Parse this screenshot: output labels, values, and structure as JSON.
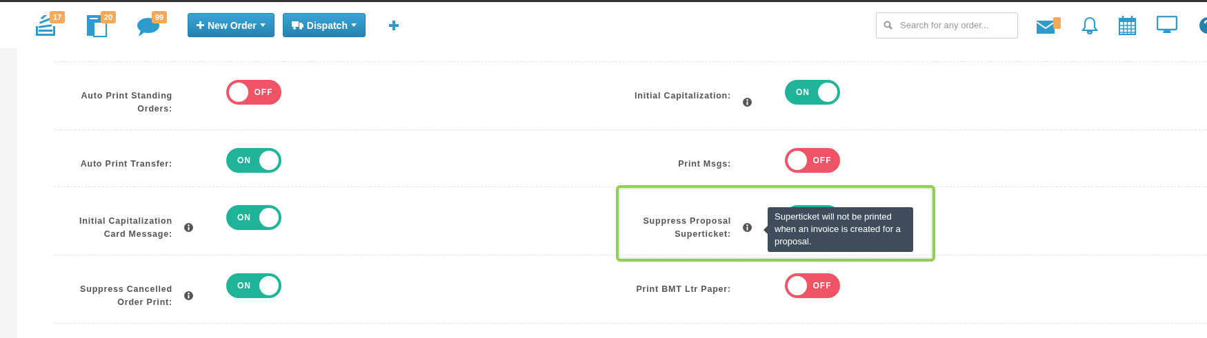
{
  "toolbar": {
    "counters": [
      {
        "kind": "stack",
        "badge": "17"
      },
      {
        "kind": "docs",
        "badge": "20"
      },
      {
        "kind": "chat",
        "badge": "99"
      }
    ],
    "buttons": [
      {
        "kind": "plus",
        "label": "New Order"
      },
      {
        "kind": "truck",
        "label": "Dispatch"
      }
    ],
    "search": {
      "placeholder": "Search for any order..."
    },
    "mail": {
      "unread": true
    }
  },
  "settings": [
    [
      {
        "label": "Auto Print Standing Orders:",
        "info": false,
        "on": false,
        "state": "OFF"
      },
      {
        "label": "Initial Capitalization:",
        "info": true,
        "on": true,
        "state": "ON"
      }
    ],
    [
      {
        "label": "Auto Print Transfer:",
        "info": false,
        "on": true,
        "state": "ON"
      },
      {
        "label": "Print Msgs:",
        "info": false,
        "on": false,
        "state": "OFF"
      }
    ],
    [
      {
        "label": "Initial Capitalization Card Message:",
        "info": true,
        "on": true,
        "state": "ON"
      },
      {
        "label": "Suppress Proposal Superticket:",
        "info": true,
        "on": true,
        "highlighted": true,
        "tooltip": "Superticket will not be printed when an invoice is created for a proposal."
      }
    ],
    [
      {
        "label": "Suppress Cancelled Order Print:",
        "info": true,
        "on": true,
        "state": "ON"
      },
      {
        "label": "Print BMT Ltr Paper:",
        "info": false,
        "on": false,
        "state": "OFF"
      }
    ]
  ]
}
